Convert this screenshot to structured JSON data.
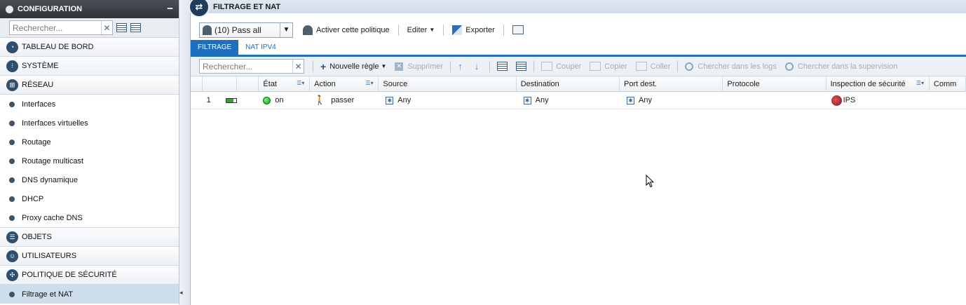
{
  "sidebar": {
    "header": "CONFIGURATION",
    "search_placeholder": "Rechercher...",
    "sections": {
      "tableau": "TABLEAU DE BORD",
      "systeme": "SYSTÈME",
      "reseau": "RÉSEAU",
      "objets": "OBJETS",
      "utilisateurs": "UTILISATEURS",
      "politique": "POLITIQUE DE SÉCURITÉ"
    },
    "reseau_items": [
      "Interfaces",
      "Interfaces virtuelles",
      "Routage",
      "Routage multicast",
      "DNS dynamique",
      "DHCP",
      "Proxy cache DNS"
    ],
    "politique_items": [
      "Filtrage et NAT"
    ]
  },
  "main": {
    "title": "FILTRAGE ET NAT",
    "policy_select": "(10) Pass all",
    "toolbar": {
      "activate": "Activer cette politique",
      "edit": "Editer",
      "export": "Exporter"
    },
    "tabs": [
      "FILTRAGE",
      "NAT IPV4"
    ],
    "rule_toolbar": {
      "search_placeholder": "Rechercher...",
      "new_rule": "Nouvelle règle",
      "delete": "Supprimer",
      "cut": "Couper",
      "copy": "Copier",
      "paste": "Coller",
      "search_logs": "Chercher dans les logs",
      "search_supervision": "Chercher dans la supervision"
    },
    "columns": {
      "etat": "État",
      "action": "Action",
      "source": "Source",
      "destination": "Destination",
      "port": "Port dest.",
      "protocole": "Protocole",
      "inspection": "Inspection de sécurité",
      "commentaire": "Comm"
    },
    "rows": [
      {
        "num": "1",
        "etat": "on",
        "action": "passer",
        "source": "Any",
        "destination": "Any",
        "port": "Any",
        "protocole": "",
        "inspection": "IPS"
      }
    ]
  },
  "colors": {
    "accent": "#1d6fbf",
    "header_dark": "#31343a",
    "status_on": "#10a010"
  }
}
